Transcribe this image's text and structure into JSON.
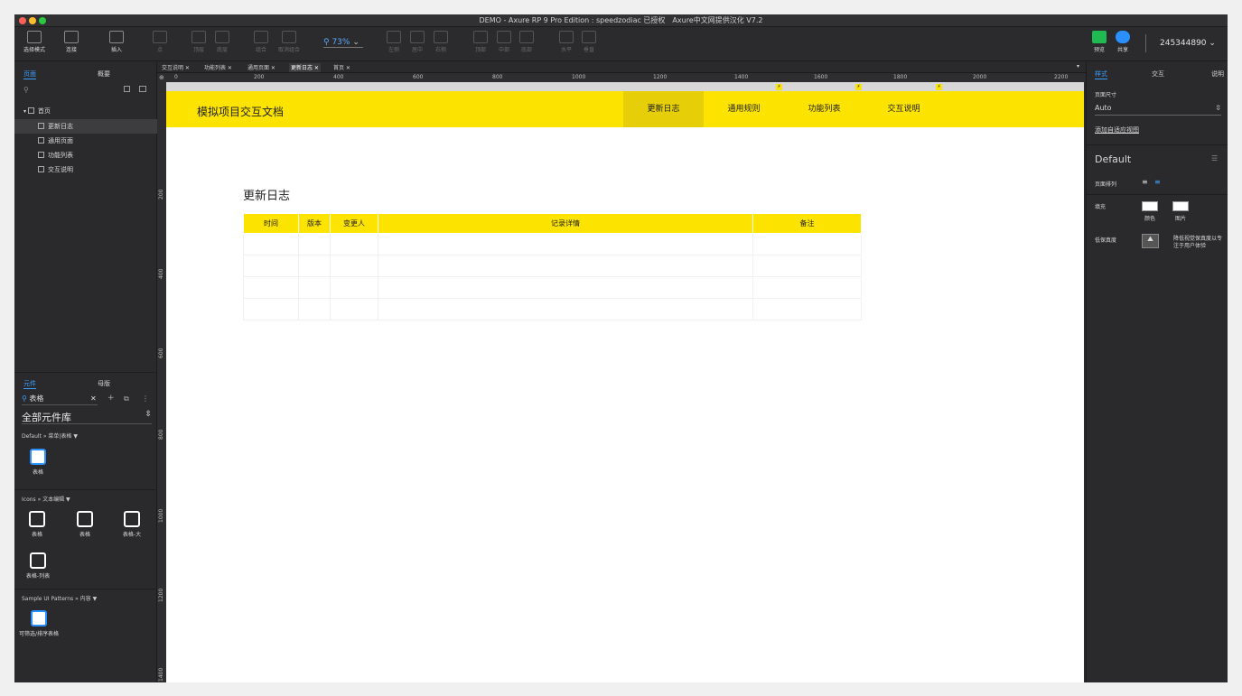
{
  "titlebar": {
    "text": "DEMO - Axure RP 9 Pro Edition : speedzodiac 已授权　Axure中文网提供汉化 V7.2"
  },
  "toolbar": {
    "select_mode": "选择模式",
    "connect": "连接",
    "insert": "插入",
    "point": "点",
    "top_layer": "顶层",
    "bottom_layer": "底层",
    "group": "组合",
    "ungroup": "取消组合",
    "zoom": "73%",
    "align_left": "左侧",
    "align_center": "居中",
    "align_right": "右侧",
    "align_top": "顶部",
    "align_middle": "中部",
    "align_bottom": "底部",
    "horizontal": "水平",
    "vertical": "垂直",
    "preview": "预览",
    "share": "共享",
    "user_id": "245344890"
  },
  "left": {
    "tab_pages": "页面",
    "tab_outline": "概要",
    "root": "首页",
    "pages": [
      "更新日志",
      "通用页面",
      "功能列表",
      "交互说明"
    ],
    "tab_widgets": "元件",
    "tab_masters": "母版",
    "search_value": "表格",
    "library": "全部元件库",
    "group1": "Default » 菜单|表格 ▼",
    "g1_item": "表格",
    "group2": "Icons » 文本编辑 ▼",
    "g2_items": [
      "表格",
      "表格",
      "表格-大",
      "表格-列表"
    ],
    "group3": "Sample UI Patterns » 内容 ▼",
    "g3_item": "可筛选/排序表格"
  },
  "doc_tabs": [
    "交互说明",
    "功能列表",
    "通用页面",
    "更新日志",
    "首页"
  ],
  "ruler": {
    "h": [
      "0",
      "200",
      "400",
      "600",
      "800",
      "1000",
      "1200",
      "1400",
      "1600",
      "1800",
      "2000",
      "2200"
    ],
    "v": [
      "200",
      "400",
      "600",
      "800",
      "1000",
      "1200",
      "1400"
    ]
  },
  "canvas": {
    "brand": "模拟项目交互文档",
    "nav": [
      "更新日志",
      "通用规则",
      "功能列表",
      "交互说明"
    ],
    "log_title": "更新日志",
    "table_headers": [
      "时间",
      "版本",
      "变更人",
      "记录详情",
      "备注"
    ],
    "rows": 4
  },
  "right": {
    "tab_style": "样式",
    "tab_interaction": "交互",
    "tab_notes": "说明",
    "page_size_label": "页面尺寸",
    "page_size": "Auto",
    "adaptive": "添加自适应视图",
    "style_name": "Default",
    "page_align": "页面排列",
    "fill": "填充",
    "fill_color": "颜色",
    "fill_image": "图片",
    "low_fidelity": "低保真度",
    "low_fidelity_desc": "降低视觉保真度以专注于用户体验"
  },
  "colors": {
    "accent": "#3aa0ff",
    "brand_yellow": "#fce300",
    "nav_active": "#e6cf08"
  }
}
